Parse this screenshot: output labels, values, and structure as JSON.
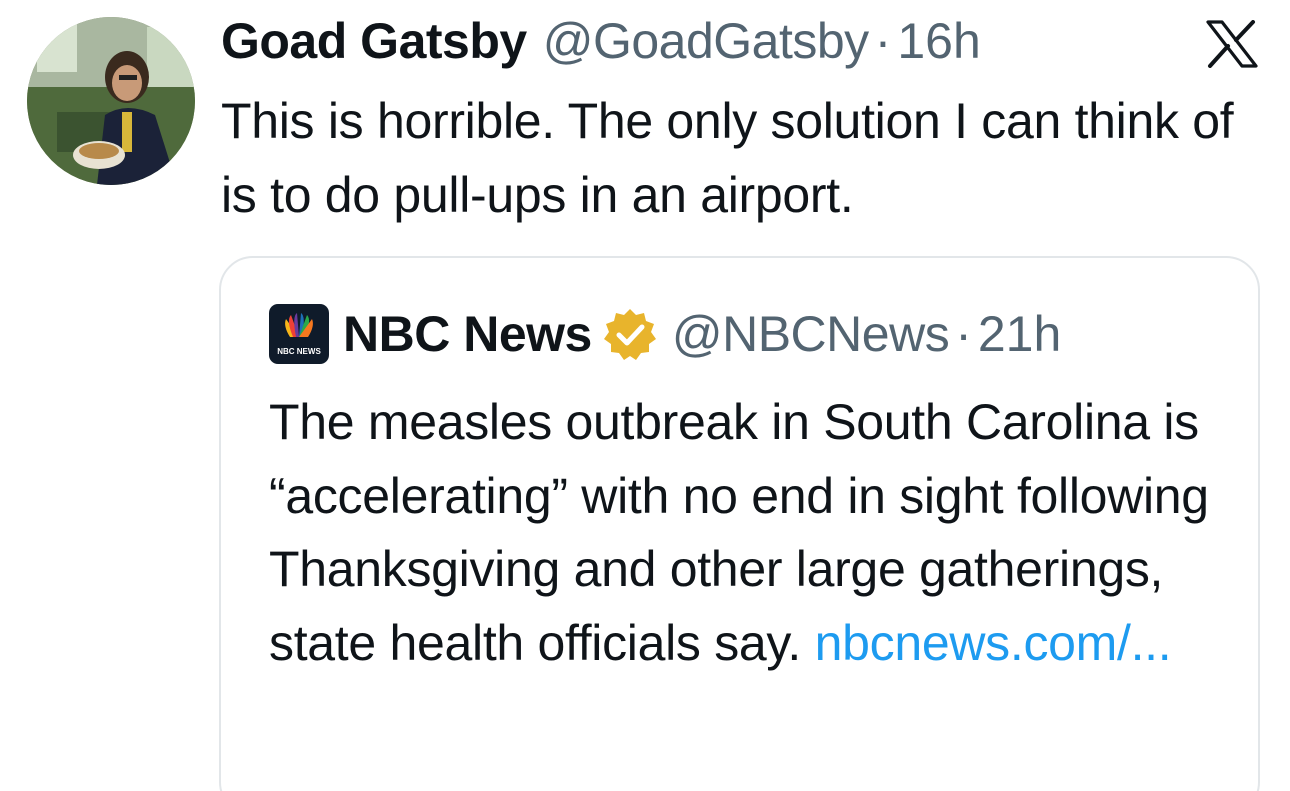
{
  "tweet": {
    "author_name": "Goad Gatsby",
    "author_handle": "@GoadGatsby",
    "separator": "·",
    "time": "16h",
    "text": "This is horrible. The only solution I can think of is to do pull-ups in an airport.",
    "avatar_icon": "profile-photo",
    "brand_icon": "x-logo-icon"
  },
  "quote": {
    "logo_text": "NBC NEWS",
    "author_name": "NBC News",
    "verified_icon": "verified-badge-icon",
    "author_handle": "@NBCNews",
    "separator": "·",
    "time": "21h",
    "text": "The measles outbreak in South Carolina is “accelerating” with no end in sight following Thanksgiving and other large gatherings, state health officials say. ",
    "link_text": "nbcnews.com/..."
  },
  "colors": {
    "text": "#0f1419",
    "secondary": "#536471",
    "link": "#1d9bf0",
    "verified_gold": "#e8b42c",
    "border": "#e2e6e9"
  }
}
